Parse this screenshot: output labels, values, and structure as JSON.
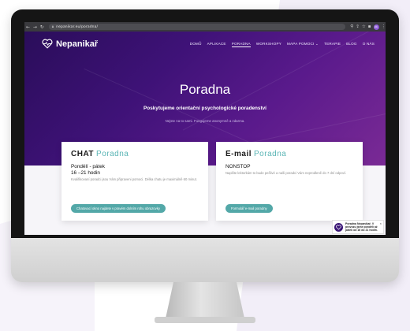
{
  "colors": {
    "hero_gradient": [
      "#2a0d5a",
      "#3e1277",
      "#5a1a8c",
      "#7a2a95"
    ],
    "accent_teal": "#5ab5b5",
    "button_teal": "#53a8a8",
    "browser_bar": "#3a3a3e"
  },
  "browser": {
    "url": "nepanikar.eu/poradna/",
    "icons": [
      "back-icon",
      "forward-icon",
      "reload-icon",
      "lock-icon",
      "search-icon",
      "share-icon",
      "star-icon",
      "extensions-icon",
      "profile-icon",
      "more-icon"
    ]
  },
  "site": {
    "logo_text": "Nepanikař",
    "nav": [
      {
        "label": "DOMŮ"
      },
      {
        "label": "APLIKACE"
      },
      {
        "label": "PORADNA"
      },
      {
        "label": "WORKSHOPY"
      },
      {
        "label": "MAPA POMOCI ⌄"
      },
      {
        "label": "TERAPIE"
      },
      {
        "label": "BLOG"
      },
      {
        "label": "O NÁS"
      }
    ],
    "active_nav": "PORADNA"
  },
  "hero": {
    "title": "Poradna",
    "subtitle": "Poskytujeme orientační psychologické poradenství",
    "note": "Nejste na to sami. Fungujeme anonymně a zdarma."
  },
  "cards": {
    "chat": {
      "title_bold": "CHAT",
      "title_light": "Poradna",
      "line1": "Pondělí - pátek",
      "line2": "16 –21 hodin",
      "desc": "Kvalifikovaní poradci jsou Vám připraveni pomoci. Délka chatu je maximálně 60 minut.",
      "button": "Chatovací okno najdete v pravém dolním rohu obrazovky"
    },
    "mail": {
      "title_bold": "E-mail",
      "title_light": "Poradna",
      "line1": "NONSTOP",
      "desc": "Napište lektorkám to bude pečlivé a naši poradci Vám neprodleně do 7 dní odpoví.",
      "button": "Formulář e-mail poradny"
    }
  },
  "notification": {
    "text": "Poradna Nepanikař. V provozu jsme pondělí až pátek od 16 do 21 hodin.",
    "close": "×"
  }
}
